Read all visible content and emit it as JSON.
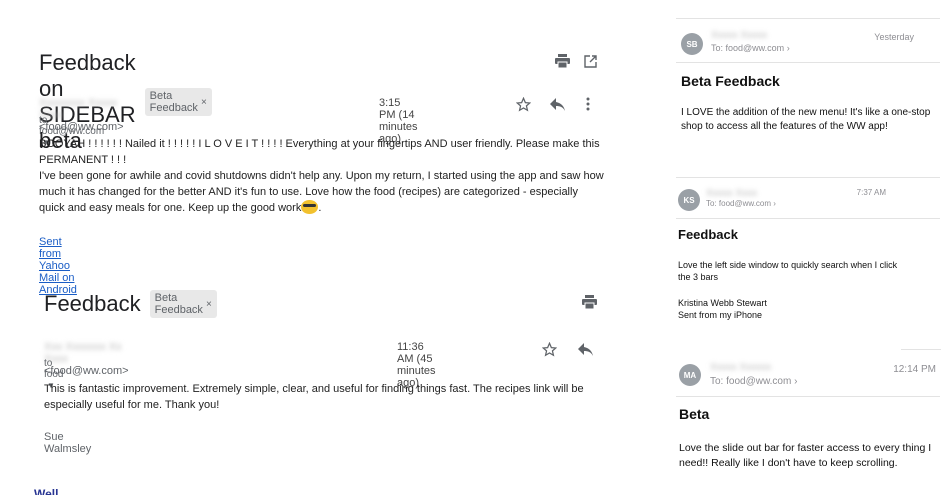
{
  "email1": {
    "subject": "Feedback on SIDEBAR beta",
    "label": "Beta Feedback",
    "sender_email": "<food@ww.com>",
    "time": "3:15 PM (14 minutes ago)",
    "to": "to food@ww.com",
    "body": [
      "BOOYAH ! ! ! ! ! !   Nailed it ! ! ! ! !   I  L O V E  I T ! ! ! !   Everything at your fingertips AND user friendly.  Please make this PERMANENT ! ! !",
      "I've been gone for awhile and covid shutdowns didn't help any.  Upon my return, I started using the app and saw how much it has changed for the better AND it's fun to use.  Love how the food (recipes) are categorized - especially quick and easy meals for one.  Keep up the good work"
    ],
    "link": "Sent from Yahoo Mail on Android"
  },
  "email2": {
    "subject": "Feedback",
    "label": "Beta Feedback",
    "sender_email": "<food@ww.com>",
    "time": "11:36 AM (45 minutes ago)",
    "to": "to food",
    "body": "This is fantastic improvement.  Extremely simple, clear, and useful for finding things fast.  The recipes link will be especially useful for me.  Thank you!",
    "signature": "Sue Walmsley"
  },
  "cut_text": "Well",
  "phone": {
    "messages": [
      {
        "initials": "SB",
        "to": "To: food@ww.com",
        "time": "Yesterday",
        "subject": "Beta Feedback",
        "body": [
          "I LOVE the addition of the new menu!  It's like a one-stop shop to access all the features of the WW app!"
        ]
      },
      {
        "initials": "KS",
        "to": "To: food@ww.com",
        "time": "7:37 AM",
        "subject": "Feedback",
        "body": [
          "Love the left side window to quickly search when I click the 3 bars",
          "Kristina Webb Stewart",
          "Sent from my iPhone"
        ]
      },
      {
        "initials": "MA",
        "to": "To: food@ww.com",
        "time": "12:14 PM",
        "subject": "Beta",
        "body": [
          "Love the slide out bar for faster access to every thing I need!! Really like I don't have to keep scrolling."
        ]
      }
    ]
  },
  "icons": {
    "print": "printer-icon",
    "open": "open-new-window-icon",
    "star": "star-icon",
    "reply": "reply-icon",
    "more": "more-vert-icon",
    "dropdown": "caret-down-icon",
    "chevron": "chevron-right-icon",
    "label_remove": "close-icon"
  }
}
